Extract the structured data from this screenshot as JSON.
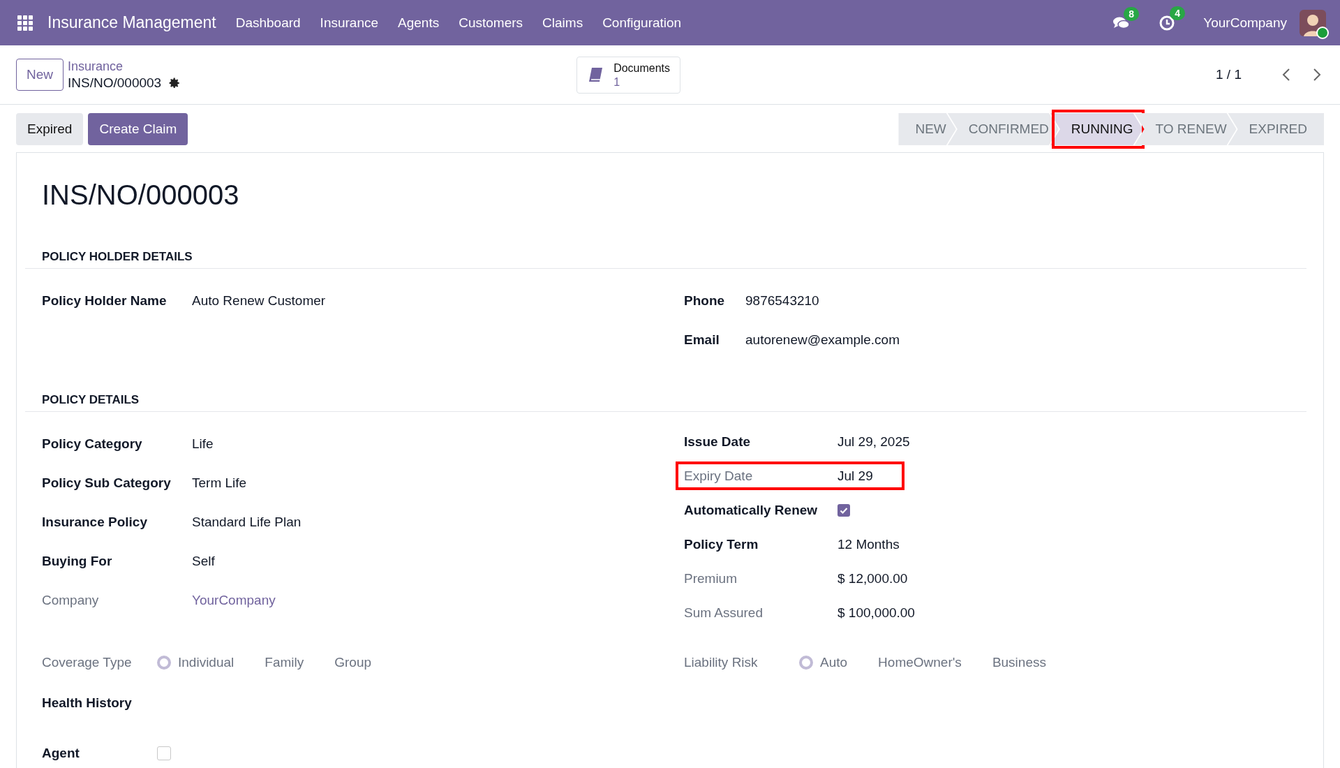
{
  "navbar": {
    "app_title": "Insurance Management",
    "menu": [
      "Dashboard",
      "Insurance",
      "Agents",
      "Customers",
      "Claims",
      "Configuration"
    ],
    "messages_count": "8",
    "activities_count": "4",
    "company": "YourCompany"
  },
  "control_panel": {
    "new_button": "New",
    "breadcrumb": "Insurance",
    "record": "INS/NO/000003",
    "documents": {
      "label": "Documents",
      "count": "1"
    },
    "pager": "1 / 1"
  },
  "actions": [
    {
      "label": "Expired",
      "kind": "secondary"
    },
    {
      "label": "Create Claim",
      "kind": "primary"
    }
  ],
  "stages": [
    {
      "label": "NEW",
      "selected": false,
      "highlighted": false
    },
    {
      "label": "CONFIRMED",
      "selected": false,
      "highlighted": false
    },
    {
      "label": "RUNNING",
      "selected": true,
      "highlighted": true
    },
    {
      "label": "TO RENEW",
      "selected": false,
      "highlighted": false
    },
    {
      "label": "EXPIRED",
      "selected": false,
      "highlighted": false
    }
  ],
  "title": "INS/NO/000003",
  "sections": [
    {
      "heading": "POLICY HOLDER DETAILS",
      "left": [
        {
          "label": "Policy Holder Name",
          "value": "Auto Renew Customer",
          "kind": "text",
          "readonly": false,
          "highlighted": false
        }
      ],
      "right": [
        {
          "label": "Phone",
          "value": "9876543210",
          "kind": "text",
          "readonly": false,
          "highlighted": false
        },
        {
          "label": "Email",
          "value": "autorenew@example.com",
          "kind": "text",
          "readonly": false,
          "highlighted": false
        }
      ]
    },
    {
      "heading": "POLICY DETAILS",
      "left": [
        {
          "label": "Policy Category",
          "value": "Life",
          "kind": "text",
          "readonly": false,
          "highlighted": false
        },
        {
          "label": "Policy Sub Category",
          "value": "Term Life",
          "kind": "text",
          "readonly": false,
          "highlighted": false
        },
        {
          "label": "Insurance Policy",
          "value": "Standard Life Plan",
          "kind": "text",
          "readonly": false,
          "highlighted": false
        },
        {
          "label": "Buying For",
          "value": "Self",
          "kind": "text",
          "readonly": false,
          "highlighted": false
        },
        {
          "label": "Company",
          "value": "YourCompany",
          "kind": "link",
          "readonly": true,
          "highlighted": false
        }
      ],
      "right": [
        {
          "label": "Issue Date",
          "value": "Jul 29, 2025",
          "kind": "text",
          "readonly": false,
          "highlighted": false
        },
        {
          "label": "Expiry Date",
          "value": "Jul 29",
          "kind": "text",
          "readonly": true,
          "highlighted": true
        },
        {
          "label": "Automatically Renew",
          "checked": true,
          "kind": "checkbox",
          "readonly": false,
          "highlighted": false
        },
        {
          "label": "Policy Term",
          "value": "12 Months",
          "kind": "text",
          "readonly": false,
          "highlighted": false
        },
        {
          "label": "Premium",
          "value": "$ 12,000.00",
          "kind": "text",
          "readonly": true,
          "highlighted": false
        },
        {
          "label": "Sum Assured",
          "value": "$ 100,000.00",
          "kind": "text",
          "readonly": true,
          "highlighted": false
        }
      ],
      "bottom_left": [
        {
          "label": "Coverage Type",
          "kind": "radio",
          "readonly": true,
          "options": [
            {
              "label": "Individual",
              "selected": true
            },
            {
              "label": "Family",
              "selected": false
            },
            {
              "label": "Group",
              "selected": false
            }
          ]
        },
        {
          "label": "Health History",
          "kind": "empty",
          "readonly": false
        },
        {
          "label": "Agent",
          "kind": "checkbox",
          "checked": false,
          "readonly": false
        }
      ],
      "bottom_right": [
        {
          "label": "Liability Risk",
          "kind": "radio",
          "readonly": true,
          "options": [
            {
              "label": "Auto",
              "selected": true
            },
            {
              "label": "HomeOwner's",
              "selected": false
            },
            {
              "label": "Business",
              "selected": false
            }
          ]
        }
      ]
    }
  ]
}
